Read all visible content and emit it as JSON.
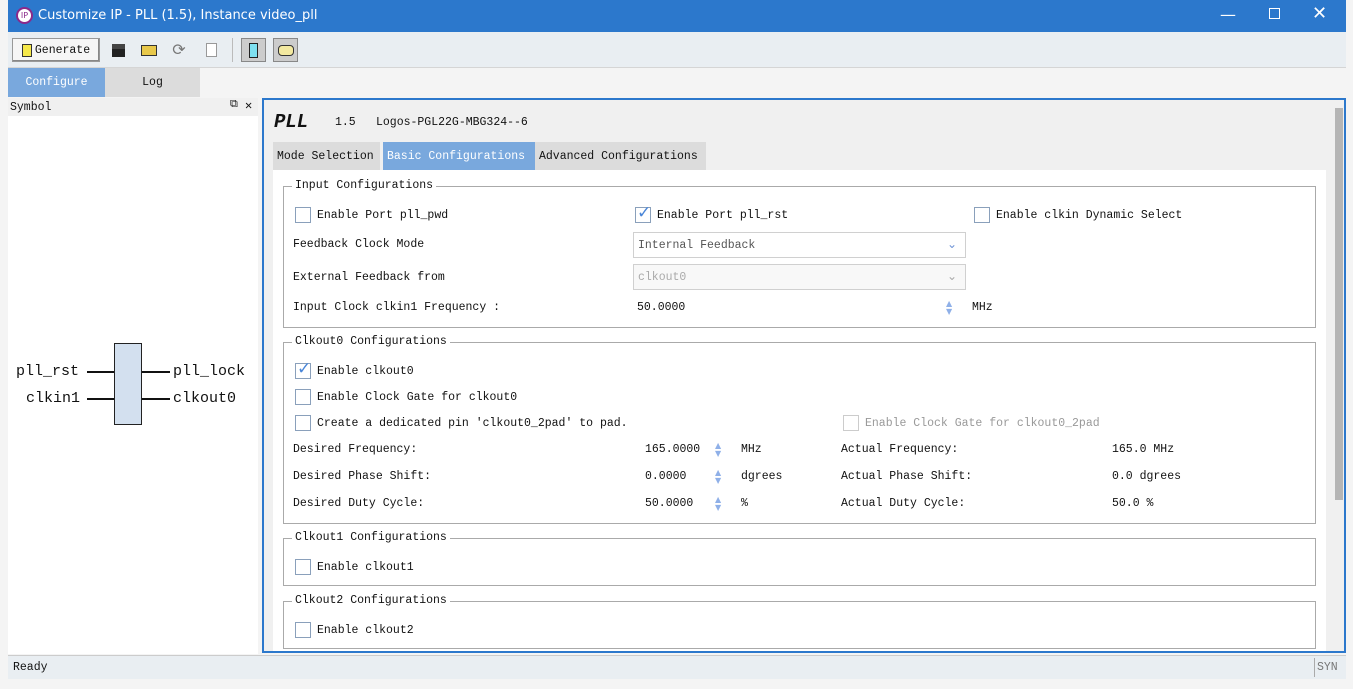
{
  "window": {
    "title": "Customize IP - PLL (1.5), Instance video_pll",
    "logo": "IP"
  },
  "toolbar": {
    "generate_label": "Generate",
    "icons": [
      "save-icon",
      "open-folder-icon",
      "refresh-icon",
      "document-icon",
      "symbol-view-icon",
      "comment-icon"
    ]
  },
  "tabs": [
    {
      "label": "Configure",
      "active": true
    },
    {
      "label": "Log",
      "active": false
    }
  ],
  "symbol_panel": {
    "title": "Symbol",
    "inputs": [
      "pll_rst",
      "clkin1"
    ],
    "outputs": [
      "pll_lock",
      "clkout0"
    ]
  },
  "ip": {
    "name": "PLL",
    "version": "1.5",
    "device": "Logos-PGL22G-MBG324--6"
  },
  "config_tabs": [
    {
      "label": "Mode Selection",
      "active": false
    },
    {
      "label": "Basic Configurations",
      "active": true
    },
    {
      "label": "Advanced Configurations",
      "active": false
    }
  ],
  "input_cfg": {
    "title": "Input Configurations",
    "pll_pwd": {
      "label": "Enable Port pll_pwd",
      "checked": false
    },
    "pll_rst": {
      "label": "Enable Port pll_rst",
      "checked": true
    },
    "dyn_sel": {
      "label": "Enable clkin Dynamic Select",
      "checked": false
    },
    "fb_mode_label": "Feedback Clock Mode",
    "fb_mode_value": "Internal Feedback",
    "ext_fb_label": "External Feedback from",
    "ext_fb_value": "clkout0",
    "freq_label": "Input Clock clkin1 Frequency :",
    "freq_value": "50.0000",
    "freq_unit": "MHz"
  },
  "clkout0": {
    "title": "Clkout0 Configurations",
    "enable": {
      "label": "Enable clkout0",
      "checked": true
    },
    "gate": {
      "label": "Enable Clock Gate for clkout0",
      "checked": false
    },
    "pad": {
      "label": "Create a dedicated pin 'clkout0_2pad' to pad.",
      "checked": false
    },
    "pad_gate": {
      "label": "Enable Clock Gate for clkout0_2pad",
      "checked": false
    },
    "rows": [
      {
        "label": "Desired Frequency:",
        "value": "165.0000",
        "unit": "MHz",
        "actual_label": "Actual Frequency:",
        "actual": "165.0 MHz"
      },
      {
        "label": "Desired Phase Shift:",
        "value": "0.0000",
        "unit": "dgrees",
        "actual_label": "Actual Phase Shift:",
        "actual": "0.0 dgrees"
      },
      {
        "label": "Desired Duty Cycle:",
        "value": "50.0000",
        "unit": "%",
        "actual_label": "Actual Duty Cycle:",
        "actual": "50.0 %"
      }
    ]
  },
  "clkout1": {
    "title": "Clkout1 Configurations",
    "enable": {
      "label": "Enable clkout1",
      "checked": false
    }
  },
  "clkout2": {
    "title": "Clkout2 Configurations",
    "enable": {
      "label": "Enable clkout2",
      "checked": false
    }
  },
  "status": {
    "text": "Ready",
    "mode": "SYN"
  }
}
